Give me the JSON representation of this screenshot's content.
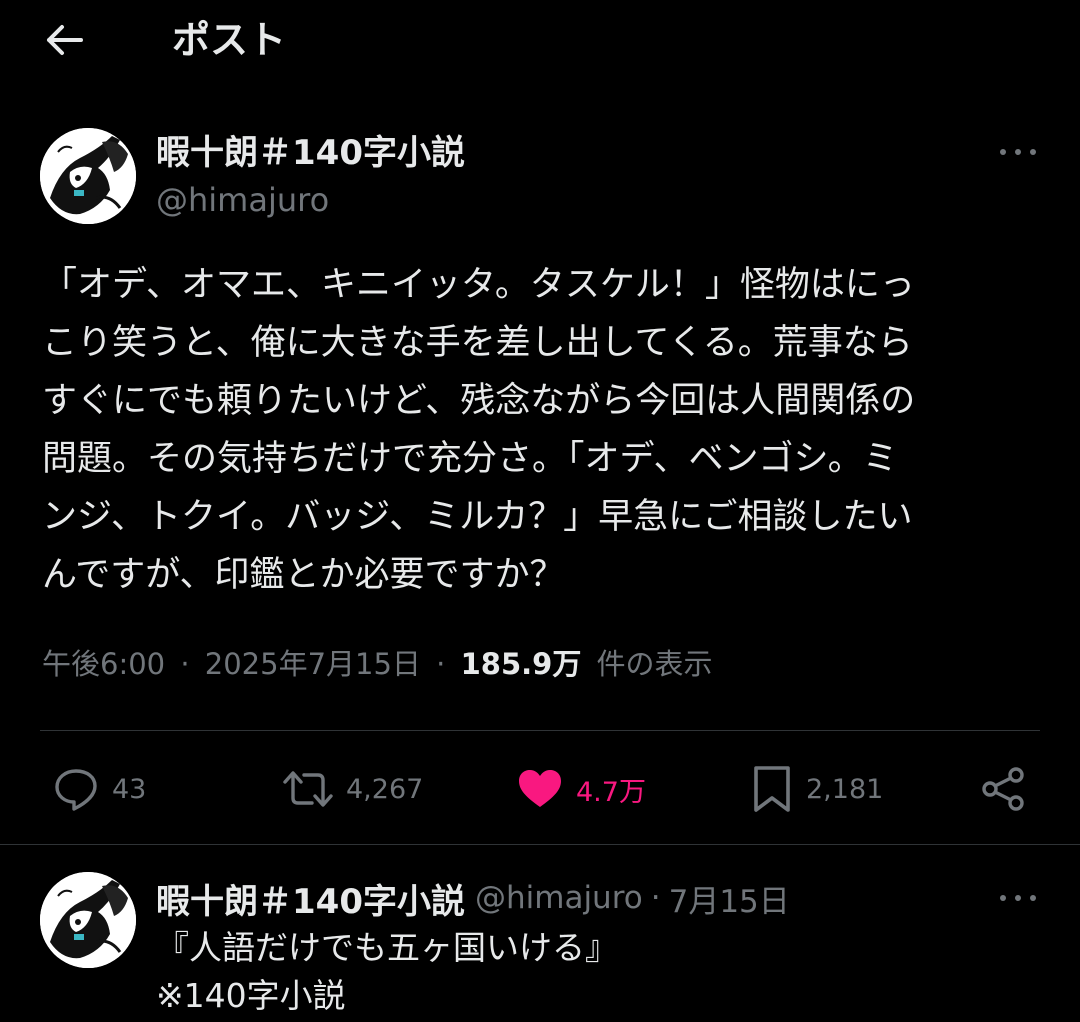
{
  "header": {
    "title": "ポスト"
  },
  "tweet": {
    "author_name": "暇十朗＃140字小説",
    "author_handle": "@himajuro",
    "text_lines": [
      "「オデ、オマエ、キニイッタ。タスケル！」怪物はにっ",
      "こり笑うと、俺に大きな手を差し出してくる。荒事なら",
      "すぐにでも頼りたいけど、残念ながら今回は人間関係の",
      "問題。その気持ちだけで充分さ。「オデ、ベンゴシ。ミ",
      "ンジ、トクイ。バッジ、ミルカ？」早急にご相談したい",
      "んですが、印鑑とか必要ですか？"
    ],
    "time": "午後6:00",
    "date": "2025年7月15日",
    "sep": "·",
    "views_count": "185.9万",
    "views_label": "件の表示",
    "actions": {
      "reply_count": "43",
      "retweet_count": "4,267",
      "like_count": "4.7万",
      "bookmark_count": "2,181"
    }
  },
  "reply": {
    "author_name": "暇十朗＃140字小説",
    "author_handle": "@himajuro",
    "sep": "·",
    "date": "7月15日",
    "text_line1": "『人語だけでも五ヶ国いける』",
    "text_line2": "※140字小説"
  },
  "colors": {
    "background": "#000000",
    "text_primary": "#e7e9ea",
    "text_secondary": "#71767b",
    "like_accent": "#f91880",
    "divider": "#2f3336"
  },
  "icons": {
    "back": "arrow-left-icon",
    "more": "more-horizontal-icon",
    "reply": "speech-bubble-icon",
    "retweet": "retweet-icon",
    "like": "heart-icon",
    "bookmark": "bookmark-icon",
    "share": "share-icon"
  }
}
